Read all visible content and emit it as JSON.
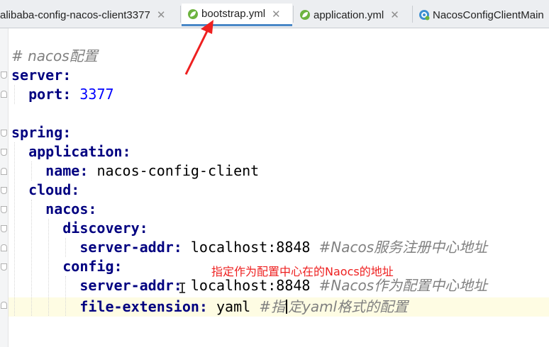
{
  "tabs": [
    {
      "label": "alibaba-config-nacos-client3377",
      "close": "✕",
      "icon": "module-icon",
      "active": false
    },
    {
      "label": "bootstrap.yml",
      "close": "✕",
      "icon": "spring-leaf-icon",
      "active": true
    },
    {
      "label": "application.yml",
      "close": "✕",
      "icon": "spring-leaf-icon",
      "active": false
    },
    {
      "label": "NacosConfigClientMain",
      "close": "",
      "icon": "class-icon",
      "active": false
    }
  ],
  "editor": {
    "comment_title": "# nacos配置",
    "server_key": "server:",
    "port_key": "port:",
    "port_value": "3377",
    "spring_key": "spring:",
    "application_key": "application:",
    "name_key": "name:",
    "name_value": "nacos-config-client",
    "cloud_key": "cloud:",
    "nacos_key": "nacos:",
    "discovery_key": "discovery:",
    "discovery_addr_key": "server-addr:",
    "discovery_addr_value": "localhost:8848",
    "discovery_comment": "#Nacos服务注册中心地址",
    "config_key": "config:",
    "config_addr_key": "server-addr:",
    "config_addr_value": "localhost:8848",
    "config_comment": "#Nacos作为配置中心地址",
    "ext_key": "file-extension:",
    "ext_value": "yaml",
    "ext_comment_1": "#指",
    "ext_comment_2": "定yaml格式的配置"
  },
  "annotation_text": "指定作为配置中心在的Naocs的地址",
  "colors": {
    "annotation": "#ee2020",
    "yaml_key": "#000080",
    "comment": "#808080",
    "number": "#0000ff",
    "active_tab_underline": "#4a88c7",
    "current_line": "#fefce3"
  }
}
